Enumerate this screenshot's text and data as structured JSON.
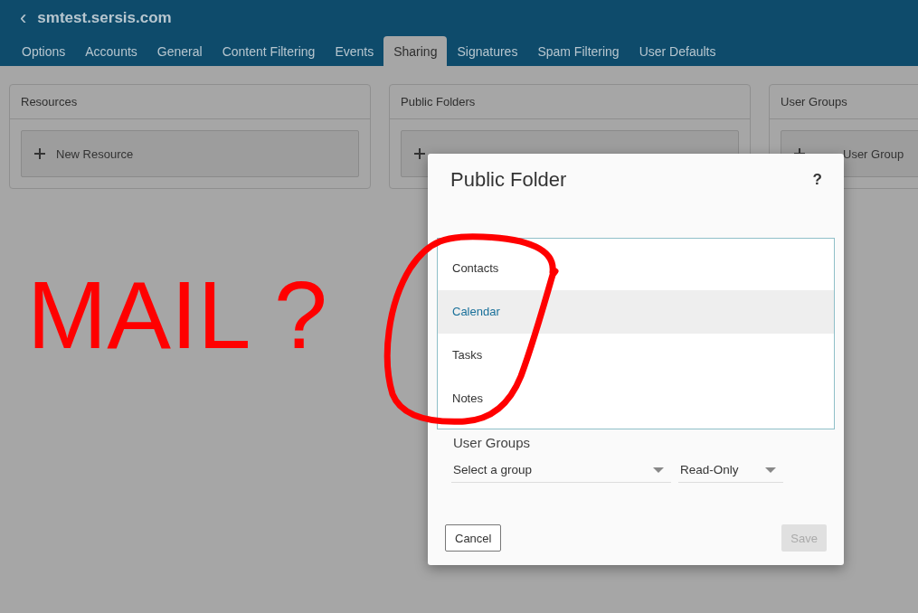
{
  "header": {
    "back": "‹",
    "title": "smtest.sersis.com"
  },
  "tabs": [
    {
      "label": "Options",
      "selected": false
    },
    {
      "label": "Accounts",
      "selected": false
    },
    {
      "label": "General",
      "selected": false
    },
    {
      "label": "Content Filtering",
      "selected": false
    },
    {
      "label": "Events",
      "selected": false
    },
    {
      "label": "Sharing",
      "selected": true
    },
    {
      "label": "Signatures",
      "selected": false
    },
    {
      "label": "Spam Filtering",
      "selected": false
    },
    {
      "label": "User Defaults",
      "selected": false
    }
  ],
  "cards": [
    {
      "title": "Resources",
      "button": "New Resource"
    },
    {
      "title": "Public Folders"
    },
    {
      "title": "User Groups",
      "button": "User Group"
    }
  ],
  "dialog": {
    "title": "Public Folder",
    "help": "?",
    "type_options": [
      {
        "label": "Contacts",
        "selected": false
      },
      {
        "label": "Calendar",
        "selected": true
      },
      {
        "label": "Tasks",
        "selected": false
      },
      {
        "label": "Notes",
        "selected": false
      }
    ],
    "user_groups_label": "User Groups",
    "group_select": {
      "value": "Select a group"
    },
    "permission_select": {
      "value": "Read-Only"
    },
    "buttons": [
      {
        "label": "Cancel",
        "kind": "secondary"
      },
      {
        "label": "Save",
        "kind": "primary",
        "disabled": true
      }
    ]
  },
  "annotation": {
    "text": "MAIL ?"
  }
}
